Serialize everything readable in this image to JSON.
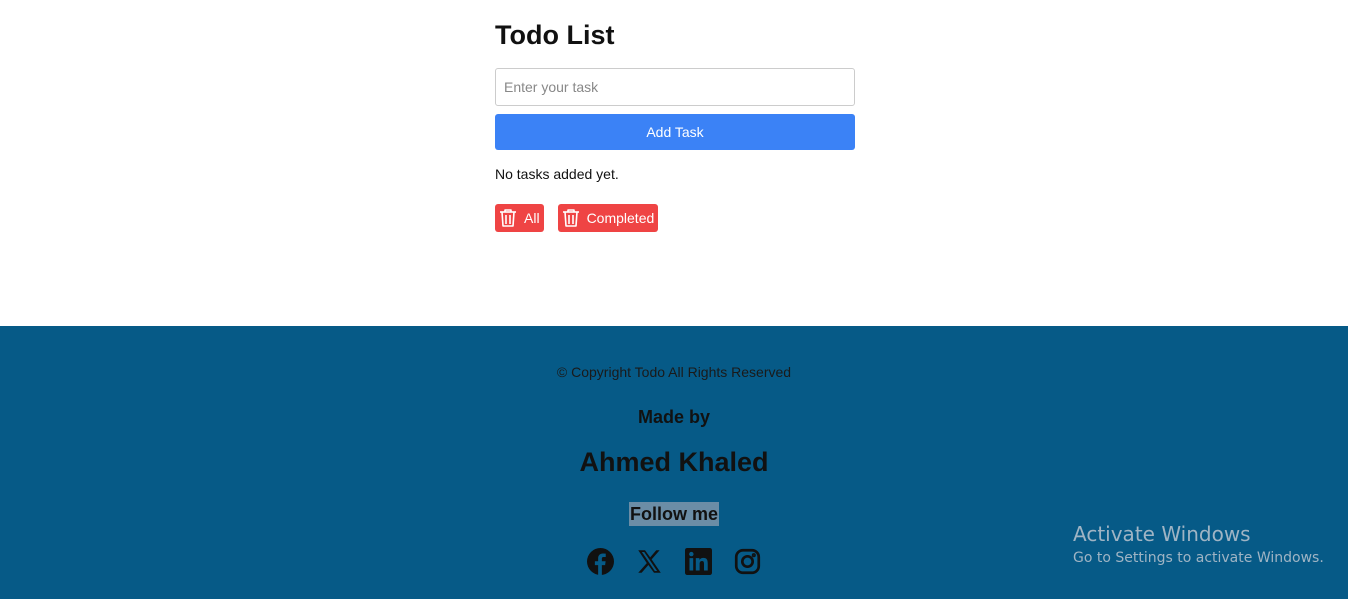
{
  "app": {
    "title": "Todo List"
  },
  "form": {
    "input_value": "",
    "input_placeholder": "Enter your task",
    "add_label": "Add Task"
  },
  "tasks": {
    "empty_message": "No tasks added yet.",
    "items": []
  },
  "actions": {
    "delete_all_label": "All",
    "delete_completed_label": "Completed",
    "icon": "trash-icon"
  },
  "footer": {
    "copyright": "© Copyright Todo All Rights Reserved",
    "made_by": "Made by",
    "author": "Ahmed Khaled",
    "follow": "Follow me",
    "socials": [
      "facebook-icon",
      "x-icon",
      "linkedin-icon",
      "instagram-icon"
    ]
  },
  "watermark": {
    "title": "Activate Windows",
    "subtitle": "Go to Settings to activate Windows."
  },
  "colors": {
    "primary": "#3b82f6",
    "danger": "#ef4444",
    "footer_bg": "#065a87"
  }
}
